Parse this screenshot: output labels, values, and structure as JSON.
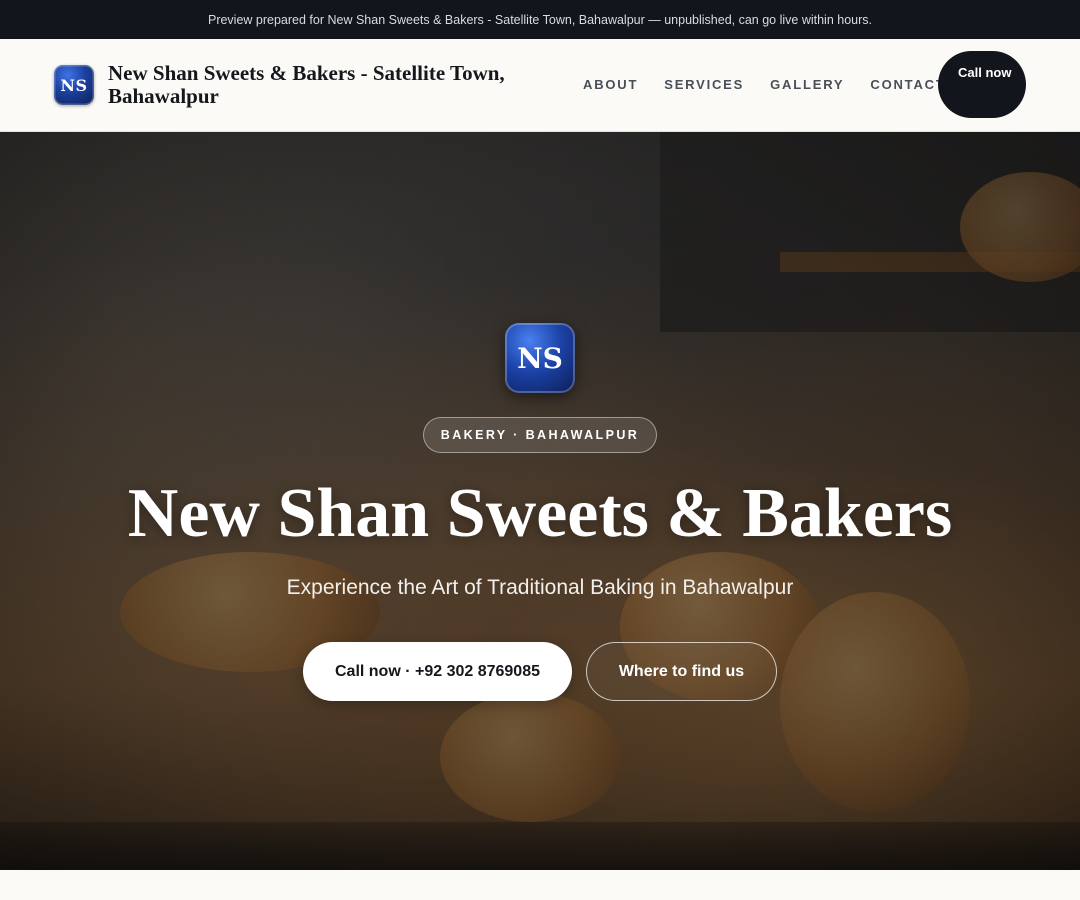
{
  "preview_bar": {
    "text": "Preview prepared for New Shan Sweets & Bakers - Satellite Town, Bahawalpur — unpublished, can go live within hours."
  },
  "header": {
    "logo_initials": "NS",
    "brand_name": "New Shan Sweets & Bakers - Satellite Town, Bahawalpur",
    "nav": [
      {
        "label": "ABOUT"
      },
      {
        "label": "SERVICES"
      },
      {
        "label": "GALLERY"
      },
      {
        "label": "CONTACT"
      }
    ],
    "call_button": "Call now"
  },
  "hero": {
    "logo_initials": "NS",
    "tag": "BAKERY · BAHAWALPUR",
    "title": "New Shan Sweets & Bakers",
    "subtitle": "Experience the Art of Traditional Baking in Bahawalpur",
    "primary_button": "Call now · +92 302 8769085",
    "secondary_button": "Where to find us"
  },
  "colors": {
    "dark": "#12151b",
    "logo_blue": "#1c43a8",
    "page_bg": "#fbfaf6"
  }
}
